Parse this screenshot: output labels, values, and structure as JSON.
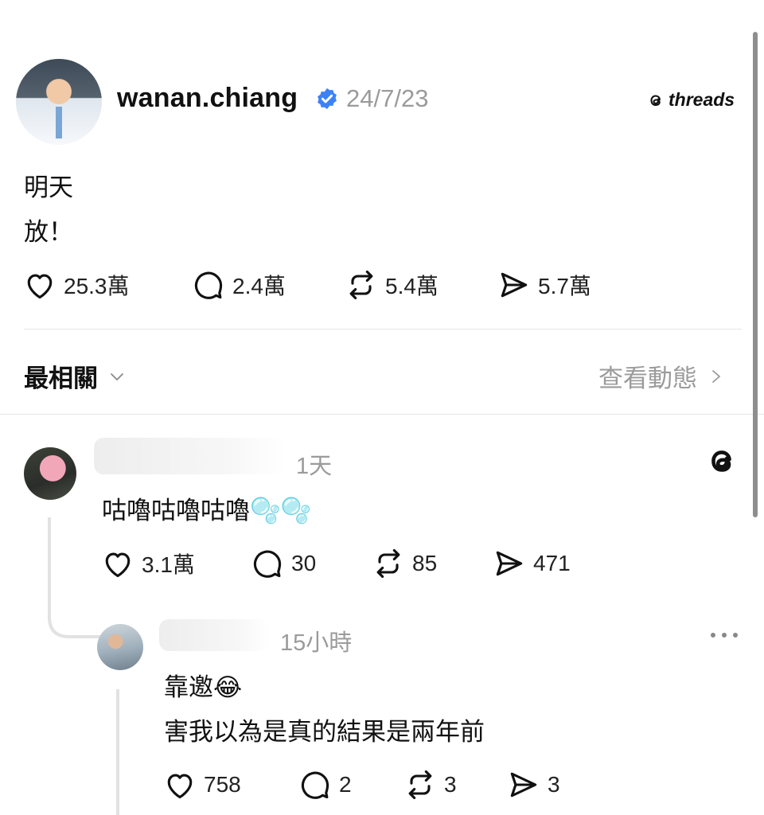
{
  "post": {
    "author": "wanan.chiang",
    "date": "24/7/23",
    "brand": "threads",
    "lines": [
      "明天",
      "放！"
    ],
    "stats": {
      "likes": "25.3萬",
      "replies": "2.4萬",
      "reposts": "5.4萬",
      "shares": "5.7萬"
    }
  },
  "replies_header": {
    "sort_label": "最相關",
    "activity_link": "查看動態"
  },
  "comments": [
    {
      "time": "1天",
      "text": "咕嚕咕嚕咕嚕🫧🫧",
      "stats": {
        "likes": "3.1萬",
        "replies": "30",
        "reposts": "85",
        "shares": "471"
      }
    },
    {
      "time": "15小時",
      "line1": "靠邀😂",
      "line2": "害我以為是真的結果是兩年前",
      "stats": {
        "likes": "758",
        "replies": "2",
        "reposts": "3",
        "shares": "3"
      }
    }
  ],
  "colors": {
    "verified": "#3b82f6",
    "muted": "#9b9b9b"
  }
}
